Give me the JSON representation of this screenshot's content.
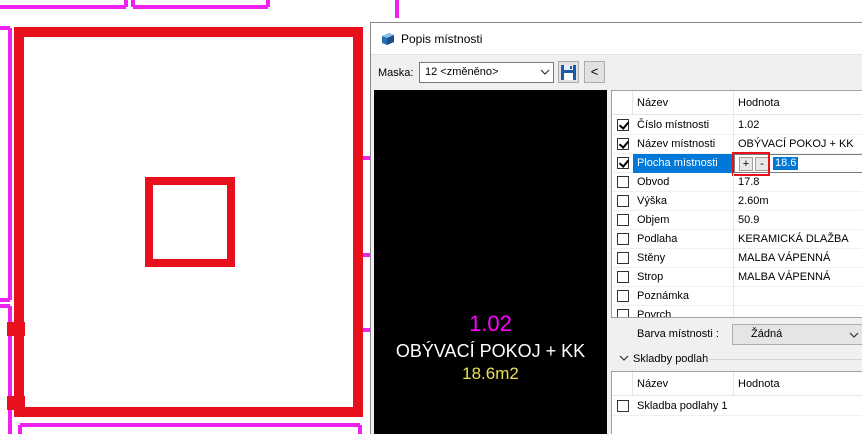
{
  "dialog": {
    "title": "Popis místnosti",
    "mask_label": "Maska:",
    "mask_value": "12 <změněno>",
    "back_label": "<"
  },
  "preview": {
    "number": "1.02",
    "name": "OBÝVACÍ POKOJ + KK",
    "area": "18.6m2"
  },
  "properties": {
    "col_name": "Název",
    "col_value": "Hodnota",
    "rows": [
      {
        "name": "Číslo místnosti",
        "value": "1.02",
        "checked": true
      },
      {
        "name": "Název místnosti",
        "value": "OBÝVACÍ POKOJ + KK",
        "checked": true
      },
      {
        "name": "Plocha místnosti",
        "value": "18.6",
        "checked": true,
        "selected": true
      },
      {
        "name": "Obvod",
        "value": "17.8",
        "checked": false
      },
      {
        "name": "Výška",
        "value": "2.60m",
        "checked": false
      },
      {
        "name": "Objem",
        "value": "50.9",
        "checked": false
      },
      {
        "name": "Podlaha",
        "value": "KERAMICKÁ DLAŽBA",
        "checked": false
      },
      {
        "name": "Stěny",
        "value": "MALBA VÁPENNÁ",
        "checked": false
      },
      {
        "name": "Strop",
        "value": "MALBA VÁPENNÁ",
        "checked": false
      },
      {
        "name": "Poznámka",
        "value": "",
        "checked": false
      },
      {
        "name": "Povrch",
        "value": "",
        "checked": false
      }
    ],
    "plus_label": "+",
    "minus_label": "-"
  },
  "room_color": {
    "label": "Barva místnosti :",
    "value": "Žádná"
  },
  "floor_compositions": {
    "label": "Skladby podlah",
    "col_name": "Název",
    "col_value": "Hodnota",
    "rows": [
      {
        "name": "Skladba podlahy 1",
        "value": "",
        "checked": false
      }
    ]
  },
  "colors": {
    "wall_red": "#e8101c",
    "magenta": "#ee22ee",
    "selection": "#0078d7",
    "preview_number": "#ff00ff",
    "preview_area": "#e8e055"
  }
}
